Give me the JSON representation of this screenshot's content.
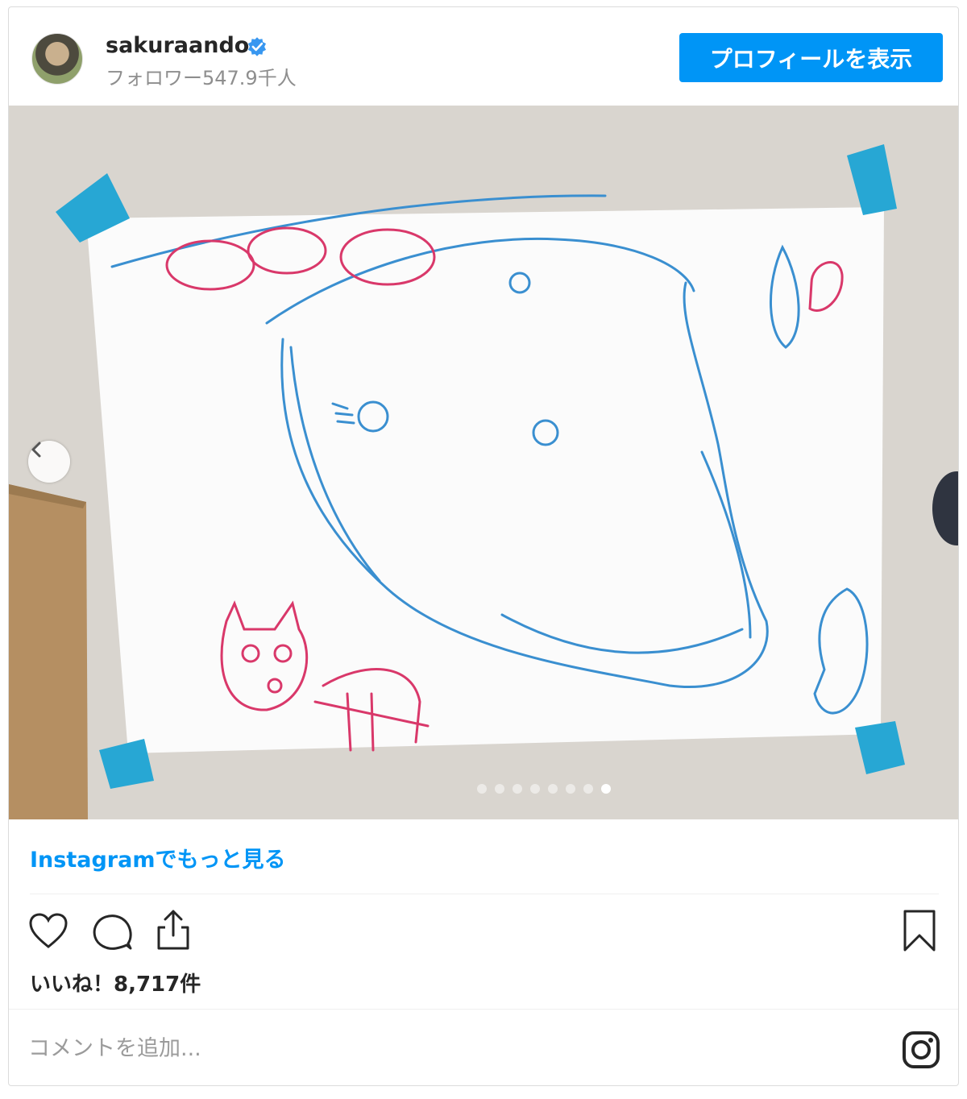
{
  "header": {
    "username": "sakuraando",
    "followers": "フォロワー547.9千人",
    "profile_button": "プロフィールを表示",
    "verified_icon": "verified-badge-icon"
  },
  "media": {
    "carousel_total": 8,
    "carousel_active_index": 8,
    "prev_icon": "chevron-left-icon"
  },
  "more_link": "Instagramでもっと見る",
  "actions": {
    "like_icon": "heart-icon",
    "comment_icon": "comment-icon",
    "share_icon": "share-icon",
    "save_icon": "bookmark-icon"
  },
  "likes": "いいね！8,717件",
  "comment": {
    "placeholder": "コメントを追加...",
    "instagram_icon": "instagram-logo-icon"
  },
  "colors": {
    "accent": "#0095f6",
    "text": "#262626",
    "muted": "#8e8e8e",
    "border": "#dbdbdb"
  }
}
